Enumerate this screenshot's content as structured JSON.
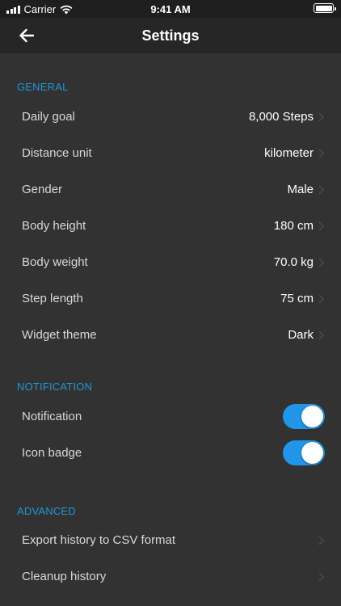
{
  "status_bar": {
    "carrier": "Carrier",
    "time": "9:41 AM"
  },
  "nav": {
    "title": "Settings",
    "back_icon": "arrow-left-icon"
  },
  "sections": {
    "general": {
      "header": "GENERAL",
      "daily_goal": {
        "label": "Daily goal",
        "value": "8,000 Steps"
      },
      "distance_unit": {
        "label": "Distance unit",
        "value": "kilometer"
      },
      "gender": {
        "label": "Gender",
        "value": "Male"
      },
      "body_height": {
        "label": "Body height",
        "value": "180 cm"
      },
      "body_weight": {
        "label": "Body weight",
        "value": "70.0 kg"
      },
      "step_length": {
        "label": "Step length",
        "value": "75 cm"
      },
      "widget_theme": {
        "label": "Widget theme",
        "value": "Dark"
      }
    },
    "notification": {
      "header": "NOTIFICATION",
      "notification": {
        "label": "Notification",
        "on": true
      },
      "icon_badge": {
        "label": "Icon badge",
        "on": true
      }
    },
    "advanced": {
      "header": "ADVANCED",
      "export": {
        "label": "Export history to CSV format"
      },
      "cleanup": {
        "label": "Cleanup history"
      }
    }
  },
  "colors": {
    "accent": "#2196e8",
    "section_header": "#2196d6",
    "background": "#323232",
    "nav_background": "#262626"
  }
}
